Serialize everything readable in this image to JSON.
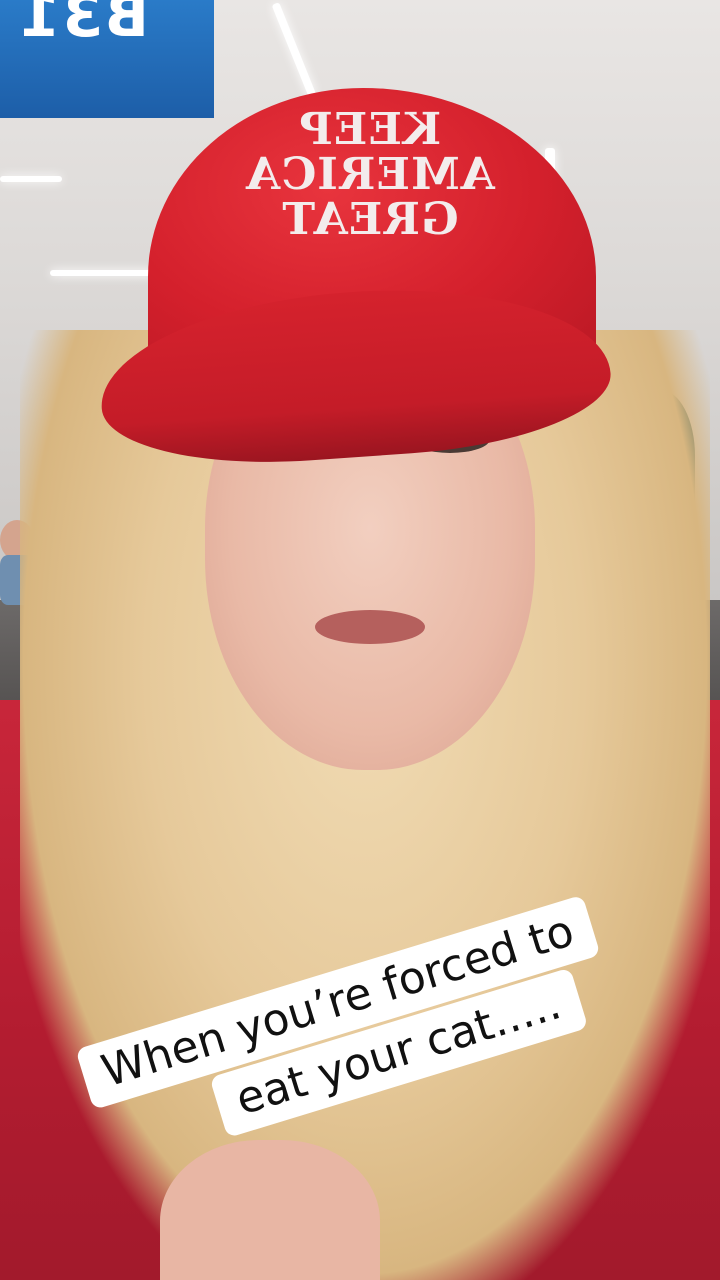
{
  "video": {
    "gate_sign_text": "B31",
    "hat_text_lines": [
      "KEEP",
      "AMERICA",
      "GREAT"
    ],
    "caption_lines": [
      "When you’re forced to",
      "eat your cat....."
    ]
  },
  "colors": {
    "hat_red": "#d4202c",
    "sign_blue": "#1d5ea8",
    "caption_bg": "#ffffff",
    "caption_text": "#111111"
  }
}
